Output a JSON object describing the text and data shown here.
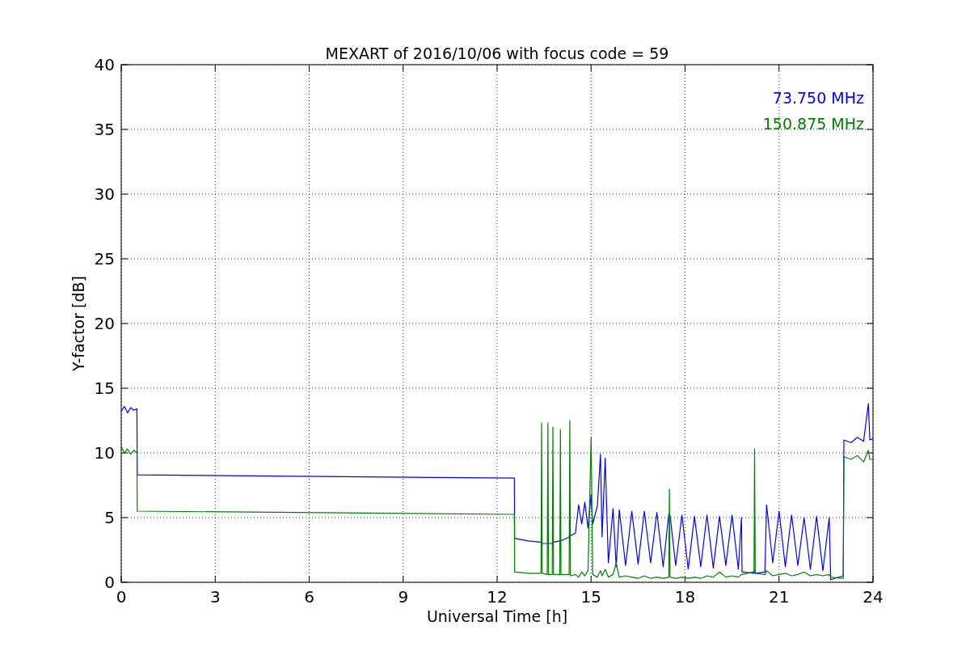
{
  "plot": {
    "chart_data": {
      "type": "line",
      "grid": true,
      "title": "MEXART of 2016/10/06 with focus code = 59",
      "xlabel": "Universal Time [h]",
      "ylabel": "Y-factor [dB]",
      "xlim": [
        0,
        24
      ],
      "ylim": [
        0,
        40
      ],
      "xticks": [
        0,
        3,
        6,
        9,
        12,
        15,
        18,
        21,
        24
      ],
      "yticks": [
        0,
        5,
        10,
        15,
        20,
        25,
        30,
        35,
        40
      ],
      "x": [
        0,
        0.1,
        0.2,
        0.3,
        0.4,
        0.5,
        0.51,
        12.55,
        12.56,
        13.0,
        13.4,
        13.42,
        13.44,
        13.6,
        13.62,
        13.64,
        13.76,
        13.78,
        13.8,
        14.0,
        14.02,
        14.04,
        14.3,
        14.32,
        14.34,
        14.5,
        14.6,
        14.7,
        14.8,
        14.9,
        15.0,
        15.05,
        15.2,
        15.3,
        15.35,
        15.45,
        15.55,
        15.7,
        15.8,
        15.9,
        16.1,
        16.3,
        16.5,
        16.7,
        16.9,
        17.1,
        17.3,
        17.48,
        17.5,
        17.52,
        17.7,
        17.9,
        18.1,
        18.3,
        18.5,
        18.7,
        18.9,
        19.1,
        19.3,
        19.5,
        19.7,
        19.8,
        19.82,
        20.2,
        20.22,
        20.24,
        20.55,
        20.6,
        20.8,
        21.0,
        21.2,
        21.4,
        21.6,
        21.8,
        22.0,
        22.2,
        22.4,
        22.6,
        22.65,
        23.05,
        23.07,
        23.3,
        23.5,
        23.7,
        23.85,
        23.9,
        24.0
      ],
      "series": [
        {
          "name": "73.750 MHz",
          "color": "#0000ff",
          "values": [
            13.2,
            13.6,
            13.1,
            13.5,
            13.3,
            13.4,
            8.3,
            8.05,
            3.4,
            3.2,
            3.1,
            3.1,
            3.0,
            3.0,
            3.0,
            3.0,
            3.0,
            3.1,
            3.1,
            3.2,
            3.2,
            3.2,
            3.5,
            3.6,
            3.6,
            3.8,
            6.0,
            4.5,
            6.2,
            4.2,
            6.8,
            4.5,
            5.9,
            9.9,
            3.5,
            9.6,
            1.5,
            5.7,
            1.2,
            5.6,
            1.3,
            5.5,
            1.4,
            5.5,
            1.5,
            5.4,
            1.2,
            5.3,
            null,
            5.2,
            1.3,
            5.2,
            1.0,
            5.1,
            1.2,
            5.2,
            1.1,
            5.1,
            1.3,
            5.2,
            1.0,
            5.0,
            0.8,
            0.7,
            0.9,
            0.7,
            0.8,
            6.0,
            1.5,
            5.5,
            1.2,
            5.2,
            1.3,
            5.0,
            1.0,
            5.1,
            0.9,
            5.0,
            0.2,
            0.5,
            11.0,
            10.8,
            11.2,
            10.9,
            13.8,
            11.0,
            11.1
          ]
        },
        {
          "name": "150.875 MHz",
          "color": "#008000",
          "values": [
            10.5,
            10.0,
            10.3,
            9.9,
            10.2,
            10.0,
            5.5,
            5.25,
            0.8,
            0.7,
            0.7,
            12.3,
            0.7,
            0.6,
            12.3,
            0.6,
            0.6,
            12.0,
            0.6,
            0.6,
            11.8,
            0.6,
            0.6,
            12.5,
            0.5,
            0.6,
            0.4,
            0.8,
            0.5,
            0.9,
            11.2,
            0.6,
            0.4,
            0.9,
            0.5,
            1.0,
            0.4,
            0.6,
            1.5,
            0.4,
            0.5,
            0.4,
            0.3,
            0.5,
            0.3,
            0.4,
            0.3,
            0.4,
            7.2,
            0.4,
            0.3,
            0.4,
            0.3,
            0.4,
            0.3,
            0.5,
            0.4,
            0.8,
            0.4,
            0.5,
            0.4,
            0.6,
            0.6,
            0.8,
            10.3,
            0.7,
            0.6,
            0.9,
            0.5,
            0.6,
            0.7,
            0.5,
            0.6,
            0.8,
            0.5,
            0.6,
            0.5,
            0.6,
            0.4,
            0.3,
            9.7,
            9.5,
            9.8,
            9.3,
            10.2,
            9.5,
            9.5
          ]
        }
      ]
    }
  }
}
